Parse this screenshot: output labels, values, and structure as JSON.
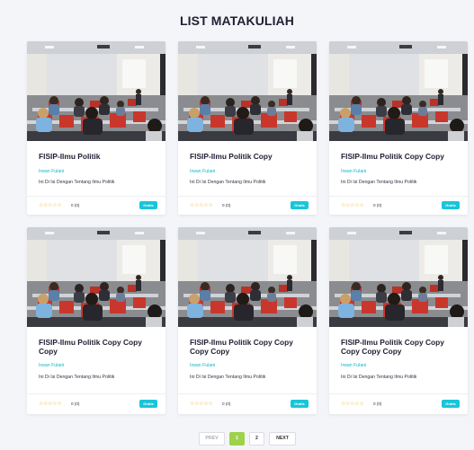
{
  "header": {
    "title": "LIST MATAKULIAH"
  },
  "courses": [
    {
      "title": "FISIP-Ilmu Politik",
      "author": "Irwan Fulani",
      "description": "Ini Di Isi Dengan Tentang Ilmu Politik",
      "stars": "☆☆☆☆☆",
      "rating": "0 (0)",
      "badge": "Gratis"
    },
    {
      "title": "FISIP-Ilmu Politik Copy",
      "author": "Irwan Fulani",
      "description": "Ini Di Isi Dengan Tentang Ilmu Politik",
      "stars": "☆☆☆☆☆",
      "rating": "0 (0)",
      "badge": "Gratis"
    },
    {
      "title": "FISIP-Ilmu Politik Copy Copy",
      "author": "Irwan Fulani",
      "description": "Ini Di Isi Dengan Tentang Ilmu Politik",
      "stars": "☆☆☆☆☆",
      "rating": "0 (0)",
      "badge": "Gratis"
    },
    {
      "title": "FISIP-Ilmu Politik Copy Copy Copy",
      "author": "Irwan Fulani",
      "description": "Ini Di Isi Dengan Tentang Ilmu Politik",
      "stars": "☆☆☆☆☆",
      "rating": "0 (0)",
      "badge": "Gratis"
    },
    {
      "title": "FISIP-Ilmu Politik Copy Copy Copy Copy",
      "author": "Irwan Fulani",
      "description": "Ini Di Isi Dengan Tentang Ilmu Politik",
      "stars": "☆☆☆☆☆",
      "rating": "0 (0)",
      "badge": "Gratis"
    },
    {
      "title": "FISIP-Ilmu Politik Copy Copy Copy Copy Copy",
      "author": "Irwan Fulani",
      "description": "Ini Di Isi Dengan Tentang Ilmu Politik",
      "stars": "☆☆☆☆☆",
      "rating": "0 (0)",
      "badge": "Gratis"
    }
  ],
  "pagination": {
    "prev": "PREV",
    "page1": "1",
    "page2": "2",
    "next": "NEXT"
  },
  "colors": {
    "accent": "#19c5d8",
    "active_page": "#9fd24a",
    "author": "#12b5c8",
    "stars": "#e9b23a"
  }
}
